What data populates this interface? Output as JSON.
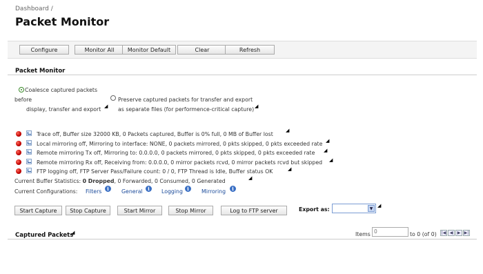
{
  "breadcrumb": "Dashboard /",
  "page_title": "Packet Monitor",
  "toolbar": {
    "configure": "Configure",
    "monitor_all": "Monitor All",
    "monitor_default": "Monitor Default",
    "clear": "Clear",
    "refresh": "Refresh"
  },
  "section_title": "Packet Monitor",
  "options": {
    "coalesce_line1": "Coalesce captured packets",
    "coalesce_line2": "before",
    "coalesce_line3": "display, transfer and export",
    "preserve_line1": "Preserve captured packets for transfer and export",
    "preserve_line2": "as separate files (for performence-critical capture)"
  },
  "status_rows": [
    "Trace off,   Buffer size 32000 KB,  0 Packets captured,   Buffer is 0% full,   0 MB of Buffer lost",
    "Local mirroring off,   Mirroring to interface: NONE,   0 packets mirrored,   0 pkts skipped,   0 pkts exceeded rate",
    "Remote mirroring Tx off,   Mirroring to: 0.0.0.0,   0 packets mirrored,   0 pkts skipped,   0 pkts exceeded rate",
    "Remote mirroring Rx off,   Receiving from: 0.0.0.0,   0 mirror packets rcvd,   0 mirror packets rcvd but skipped",
    "FTP logging off,   FTP Server Pass/Failure count: 0 / 0,   FTP Thread is Idle,   Buffer status OK"
  ],
  "buffer_stats": {
    "label": "Current Buffer Statistics:",
    "dropped": "0 Dropped",
    "rest": ", 0 Forwarded, 0 Consumed, 0 Generated"
  },
  "configs": {
    "label": "Current Configurations:",
    "filters": "Filters",
    "general": "General",
    "logging": "Logging",
    "mirroring": "Mirroring"
  },
  "actions": {
    "start_capture": "Start Capture",
    "stop_capture": "Stop Capture",
    "start_mirror": "Start Mirror",
    "stop_mirror": "Stop Mirror",
    "log_ftp": "Log to FTP server",
    "export_label": "Export as:"
  },
  "captured": {
    "title": "Captured Packets",
    "items_label": "Items",
    "items_value": "0",
    "range": "to 0 (of 0)"
  },
  "colors": {
    "status_bullet": "#c00000",
    "link": "#1a4a9a",
    "info_icon": "#3a6fc4"
  }
}
